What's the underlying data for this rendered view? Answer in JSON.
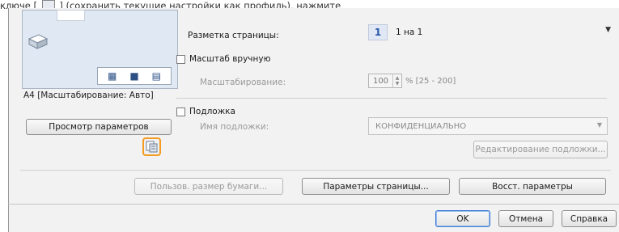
{
  "caption": {
    "before_icon": "ключе [",
    "after_icon": "] (сохранить текущие настройки как профиль), нажмите",
    "icon": "watermark-settings-icon"
  },
  "preview": {
    "paper_caption": "A4 [Масштабирование: Авто]",
    "layout_icons": [
      "page-layout-icon",
      "duplex-icon",
      "booklet-icon"
    ],
    "preview_settings_button": "Просмотр параметров"
  },
  "page_layout": {
    "label": "Разметка страницы:",
    "badge": "1",
    "value": "1 на 1"
  },
  "manual_scaling": {
    "checkbox_label": "Масштаб вручную",
    "checked": false,
    "scaling_label": "Масштабирование:",
    "value": "100",
    "range": "% [25 - 200]"
  },
  "watermark": {
    "checkbox_label": "Подложка",
    "checked": false,
    "name_label": "Имя подложки:",
    "name_value": "КОНФИДЕНЦИАЛЬНО",
    "edit_button": "Редактирование подложки..."
  },
  "bottom_buttons": {
    "custom_paper": "Пользов. размер бумаги...",
    "page_options": "Параметры страницы...",
    "restore": "Восст. параметры"
  },
  "footer": {
    "ok": "OK",
    "cancel": "Отмена",
    "help": "Справка"
  },
  "colors": {
    "highlight": "#f39c1f",
    "accent": "#2a55a8"
  }
}
